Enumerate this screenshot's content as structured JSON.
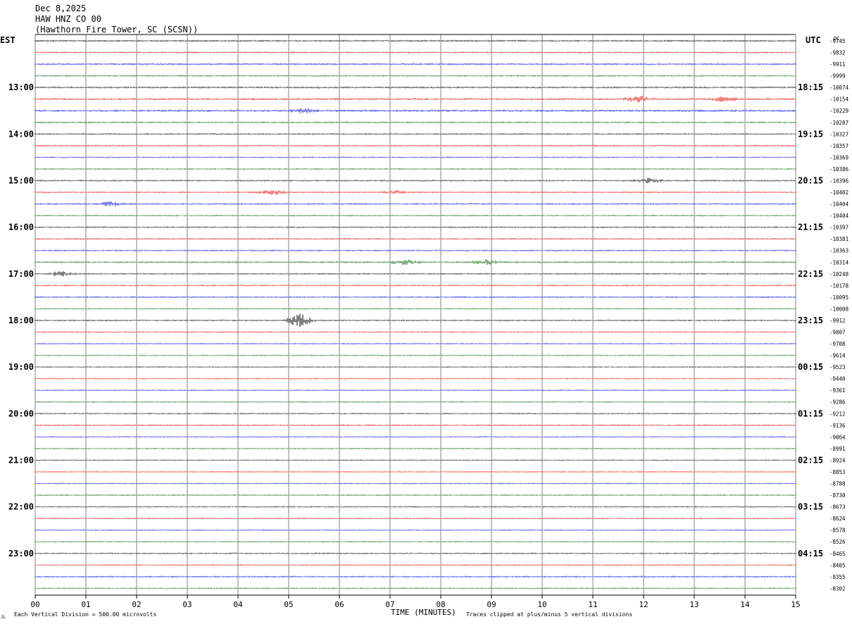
{
  "header": {
    "date": "Dec 8,2025",
    "station": "HAW HNZ CO 00",
    "location": "(Hawthorn Fire Tower, SC (SCSN))"
  },
  "left_zone": "EST",
  "right_zone": "UTC",
  "dc_label": "DC",
  "footer": {
    "xlabel": "TIME (MINUTES)",
    "scale_note": "Each Vertical Division =  500.00 microvolts",
    "clip_note": "Traces clipped at plus/minus 5 vertical divisions",
    "corner_mark": "JL"
  },
  "chart_data": {
    "type": "line",
    "title": "HAW HNZ CO 00",
    "xlabel": "TIME (MINUTES)",
    "xlim": [
      0,
      15
    ],
    "x_ticks": [
      "00",
      "01",
      "02",
      "03",
      "04",
      "05",
      "06",
      "07",
      "08",
      "09",
      "10",
      "11",
      "12",
      "13",
      "14",
      "15"
    ],
    "rows_per_hour": 4,
    "minutes_per_row": 15,
    "trace_colors": [
      "#000000",
      "#e00000",
      "#0000e0",
      "#006400"
    ],
    "hour_labels_est": [
      "13:00",
      "14:00",
      "15:00",
      "16:00",
      "17:00",
      "18:00",
      "19:00",
      "20:00",
      "21:00",
      "22:00",
      "23:00"
    ],
    "hour_labels_utc": [
      "18:15",
      "19:15",
      "20:15",
      "21:15",
      "22:15",
      "23:15",
      "00:15",
      "01:15",
      "02:15",
      "03:15",
      "04:15"
    ],
    "dc_offsets": [
      -9745,
      -9832,
      -9911,
      -9999,
      -10074,
      -10154,
      -10229,
      -10287,
      -10327,
      -10357,
      -10369,
      -10386,
      -10396,
      -10402,
      -10404,
      -10404,
      -10397,
      -10381,
      -10363,
      -10314,
      -10248,
      -10178,
      -10095,
      -10008,
      -9912,
      -9807,
      -9708,
      -9614,
      -9523,
      -9440,
      -9361,
      -9286,
      -9212,
      -9136,
      -9064,
      -8991,
      -8924,
      -8853,
      -8788,
      -8730,
      -8673,
      -8624,
      -8578,
      -8526,
      -8465,
      -8405,
      -8355,
      -8302
    ],
    "noise_level": [
      1.0,
      0.8,
      1.0,
      0.8,
      1.0,
      1.1,
      1.2,
      0.9,
      0.8,
      0.8,
      0.7,
      0.7,
      0.8,
      0.8,
      0.9,
      0.7,
      0.8,
      0.8,
      0.8,
      1.0,
      0.8,
      0.8,
      0.8,
      0.7,
      0.8,
      0.7,
      0.6,
      0.6,
      0.6,
      0.6,
      0.6,
      0.6,
      0.7,
      0.8,
      0.6,
      0.6,
      0.6,
      0.6,
      0.6,
      0.7,
      0.7,
      0.6,
      0.6,
      0.6,
      0.7,
      0.6,
      0.8,
      0.7
    ],
    "events": [
      {
        "row": 5,
        "minute": 11.9,
        "amplitude": 4
      },
      {
        "row": 5,
        "minute": 13.6,
        "amplitude": 3
      },
      {
        "row": 6,
        "minute": 5.3,
        "amplitude": 3
      },
      {
        "row": 12,
        "minute": 12.1,
        "amplitude": 3
      },
      {
        "row": 13,
        "minute": 4.7,
        "amplitude": 3
      },
      {
        "row": 13,
        "minute": 7.1,
        "amplitude": 2
      },
      {
        "row": 14,
        "minute": 1.5,
        "amplitude": 3
      },
      {
        "row": 19,
        "minute": 7.3,
        "amplitude": 4
      },
      {
        "row": 19,
        "minute": 8.9,
        "amplitude": 3
      },
      {
        "row": 20,
        "minute": 0.5,
        "amplitude": 3
      },
      {
        "row": 24,
        "minute": 5.2,
        "amplitude": 9
      }
    ]
  }
}
